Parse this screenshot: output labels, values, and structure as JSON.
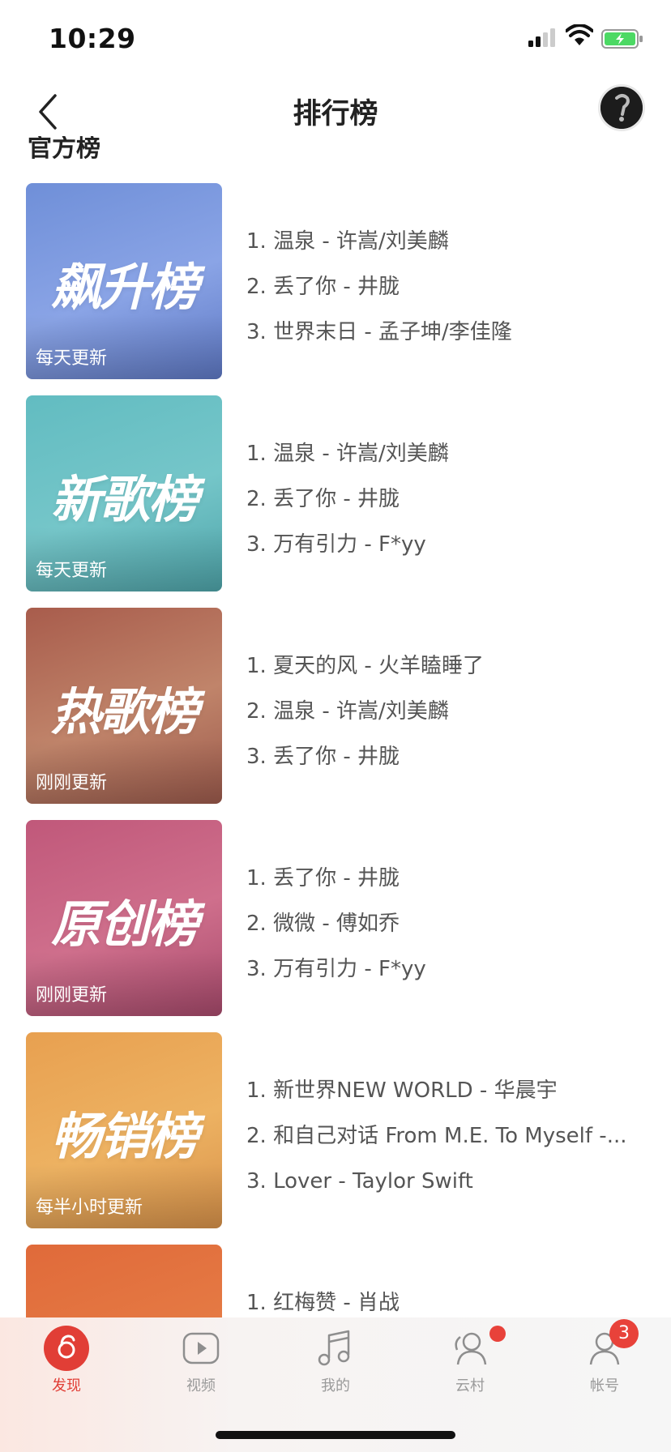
{
  "status_bar": {
    "time": "10:29"
  },
  "header": {
    "title": "排行榜"
  },
  "section": {
    "title": "官方榜"
  },
  "charts": [
    {
      "logo": "飙升榜",
      "update": "每天更新",
      "colors": [
        "#6f8fd8",
        "#8aa4e6",
        "#5e78c4"
      ],
      "songs": [
        "1. 温泉 - 许嵩/刘美麟",
        "2. 丢了你 - 井胧",
        "3. 世界末日 - 孟子坤/李佳隆"
      ]
    },
    {
      "logo": "新歌榜",
      "update": "每天更新",
      "colors": [
        "#62bcc1",
        "#75c6c9",
        "#4ea4a9"
      ],
      "songs": [
        "1. 温泉 - 许嵩/刘美麟",
        "2. 丢了你 - 井胧",
        "3. 万有引力 - F*yy"
      ]
    },
    {
      "logo": "热歌榜",
      "update": "刚刚更新",
      "colors": [
        "#a85c4c",
        "#c0846a",
        "#9c5a4c"
      ],
      "songs": [
        "1. 夏天的风 - 火羊瞌睡了",
        "2. 温泉 - 许嵩/刘美麟",
        "3. 丢了你 - 井胧"
      ]
    },
    {
      "logo": "原创榜",
      "update": "刚刚更新",
      "colors": [
        "#c0587a",
        "#cf6f8c",
        "#a84a6c"
      ],
      "songs": [
        "1. 丢了你 - 井胧",
        "2. 微微 - 傅如乔",
        "3. 万有引力 - F*yy"
      ]
    },
    {
      "logo": "畅销榜",
      "update": "每半小时更新",
      "colors": [
        "#e8a050",
        "#edb262",
        "#d8924a"
      ],
      "songs": [
        "1. 新世界NEW WORLD - 华晨宇",
        "2. 和自己对话 From M.E. To Myself -...",
        "3. Lover - Taylor Swift"
      ]
    },
    {
      "logo": "",
      "update": "",
      "colors": [
        "#e06a3a",
        "#e57a44",
        "#d96236"
      ],
      "songs": [
        "1. 红梅赞 - 肖战",
        "",
        ""
      ]
    }
  ],
  "tabbar": {
    "tabs": [
      {
        "label": "发现",
        "icon": "discover-icon"
      },
      {
        "label": "视频",
        "icon": "video-icon"
      },
      {
        "label": "我的",
        "icon": "music-icon"
      },
      {
        "label": "云村",
        "icon": "community-icon"
      },
      {
        "label": "帐号",
        "icon": "account-icon"
      }
    ],
    "account_badge": "3",
    "accent": "#e13e36"
  }
}
